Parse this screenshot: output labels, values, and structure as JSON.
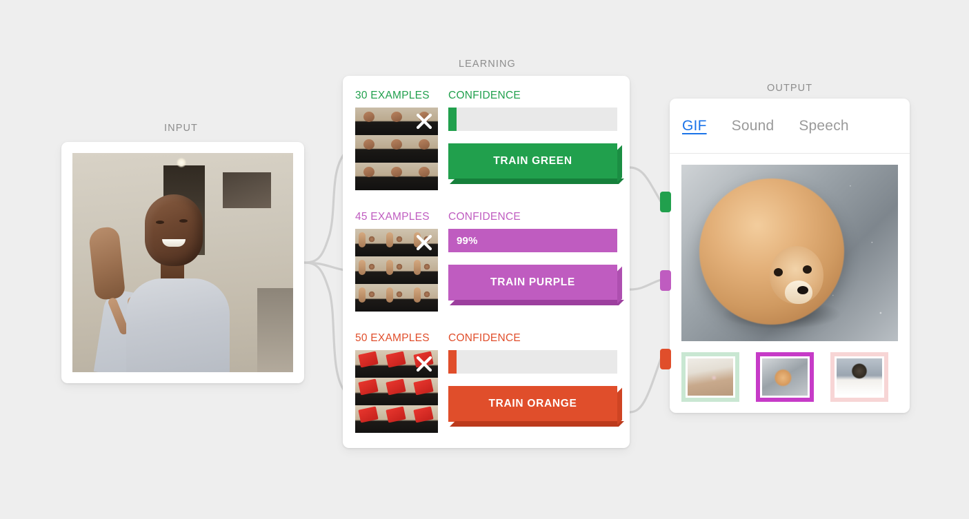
{
  "sections": {
    "input_label": "INPUT",
    "learning_label": "LEARNING",
    "output_label": "OUTPUT"
  },
  "colors": {
    "green": "#21a04d",
    "green_shade": "#16803b",
    "green_shade2": "#1b8e43",
    "purple": "#bf5cc0",
    "purple_shade": "#9c3f9e",
    "purple_shade2": "#ae4fb0",
    "orange": "#e04e2b",
    "orange_shade": "#bc3a1c",
    "orange_shade2": "#cf4423",
    "label_gray": "#8d8d8d",
    "bar_empty": "#e9e9e9",
    "tab_active": "#1a73e8",
    "tab_inactive": "#9a9a9a",
    "thumb_border_green": "#c9e7d2",
    "thumb_border_purple": "#c63bc7",
    "thumb_border_pink": "#f7d5d5"
  },
  "classes": [
    {
      "id": "green",
      "examples_label": "30 EXAMPLES",
      "confidence_label": "CONFIDENCE",
      "confidence_value": "",
      "confidence_percent": 0,
      "train_label": "TRAIN GREEN",
      "color": "#21a04d",
      "shade": "#16803b",
      "shade2": "#1b8e43",
      "remove_icon": "close-x-icon",
      "thumb_class": "g"
    },
    {
      "id": "purple",
      "examples_label": "45 EXAMPLES",
      "confidence_label": "CONFIDENCE",
      "confidence_value": "99%",
      "confidence_percent": 100,
      "train_label": "TRAIN PURPLE",
      "color": "#bf5cc0",
      "shade": "#9c3f9e",
      "shade2": "#ae4fb0",
      "remove_icon": "close-x-icon",
      "thumb_class": "p"
    },
    {
      "id": "orange",
      "examples_label": "50 EXAMPLES",
      "confidence_label": "CONFIDENCE",
      "confidence_value": "",
      "confidence_percent": 0,
      "train_label": "TRAIN ORANGE",
      "color": "#e04e2b",
      "shade": "#bc3a1c",
      "shade2": "#cf4423",
      "remove_icon": "close-x-icon",
      "thumb_class": "o"
    }
  ],
  "output": {
    "tabs": [
      {
        "label": "GIF",
        "active": true
      },
      {
        "label": "Sound",
        "active": false
      },
      {
        "label": "Speech",
        "active": false
      }
    ],
    "preview_alt": "pomeranian-dog-gif",
    "thumbnails": [
      {
        "name": "white-cat-thumbnail",
        "border": "#c9e7d2",
        "pic_class": "cat",
        "selected": false
      },
      {
        "name": "pomeranian-dog-thumbnail",
        "border": "#c63bc7",
        "pic_class": "dog",
        "selected": true
      },
      {
        "name": "dark-rabbit-thumbnail",
        "border": "#f7d5d5",
        "pic_class": "rabbit",
        "selected": false
      }
    ]
  },
  "input": {
    "webcam_alt": "webcam-person-peace-sign"
  }
}
